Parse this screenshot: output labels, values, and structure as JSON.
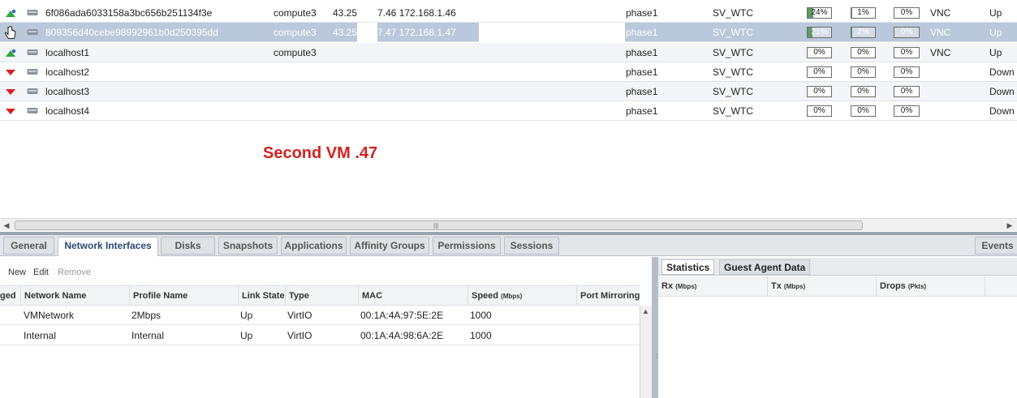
{
  "vm_rows": [
    {
      "name": "6f086ada6033158a3bc656b251134f3e",
      "host": "compute3",
      "ip_prefix": "43.25",
      "ip": "7.46 172.168.1.46",
      "cluster": "phase1",
      "datacenter": "SV_WTC",
      "cpu": "24%",
      "cpu_value": 24,
      "memory": "1%",
      "memory_value": 1,
      "network": "0%",
      "network_value": 0,
      "display": "VNC",
      "status": "Up",
      "state": "up"
    },
    {
      "name": "809356d40cebe98992961b0d250395dd",
      "host": "compute3",
      "ip_prefix": "43.25",
      "ip": "7.47 172.168.1.47",
      "cluster": "phase1",
      "datacenter": "SV_WTC",
      "cpu": "21%",
      "cpu_value": 21,
      "memory": "2%",
      "memory_value": 2,
      "network": "0%",
      "network_value": 0,
      "display": "VNC",
      "status": "Up",
      "state": "up"
    },
    {
      "name": "localhost1",
      "host": "compute3",
      "ip_prefix": "",
      "ip": "",
      "cluster": "phase1",
      "datacenter": "SV_WTC",
      "cpu": "0%",
      "cpu_value": 0,
      "memory": "0%",
      "memory_value": 0,
      "network": "0%",
      "network_value": 0,
      "display": "VNC",
      "status": "Up",
      "state": "up"
    },
    {
      "name": "localhost2",
      "host": "",
      "ip_prefix": "",
      "ip": "",
      "cluster": "phase1",
      "datacenter": "SV_WTC",
      "cpu": "0%",
      "cpu_value": 0,
      "memory": "0%",
      "memory_value": 0,
      "network": "0%",
      "network_value": 0,
      "display": "",
      "status": "Down",
      "state": "down"
    },
    {
      "name": "localhost3",
      "host": "",
      "ip_prefix": "",
      "ip": "",
      "cluster": "phase1",
      "datacenter": "SV_WTC",
      "cpu": "0%",
      "cpu_value": 0,
      "memory": "0%",
      "memory_value": 0,
      "network": "0%",
      "network_value": 0,
      "display": "",
      "status": "Down",
      "state": "down"
    },
    {
      "name": "localhost4",
      "host": "",
      "ip_prefix": "",
      "ip": "",
      "cluster": "phase1",
      "datacenter": "SV_WTC",
      "cpu": "0%",
      "cpu_value": 0,
      "memory": "0%",
      "memory_value": 0,
      "network": "0%",
      "network_value": 0,
      "display": "",
      "status": "Down",
      "state": "down"
    }
  ],
  "annotation": "Second VM .47",
  "tabs": [
    "General",
    "Network Interfaces",
    "Disks",
    "Snapshots",
    "Applications",
    "Affinity Groups",
    "Permissions",
    "Sessions"
  ],
  "active_tab": "Network Interfaces",
  "events_tab": "Events",
  "nic_toolbar": {
    "new": "New",
    "edit": "Edit",
    "remove": "Remove"
  },
  "nic_columns": {
    "plugged": "ged",
    "network_name": "Network Name",
    "profile_name": "Profile Name",
    "link_state": "Link State",
    "type": "Type",
    "mac": "MAC",
    "speed": "Speed",
    "speed_unit": "(Mbps)",
    "port_mirroring": "Port Mirroring"
  },
  "nics": [
    {
      "network_name": "VMNetwork",
      "profile_name": "2Mbps",
      "link_state": "Up",
      "type": "VirtIO",
      "mac": "00:1A:4A:97:5E:2E",
      "speed": "1000"
    },
    {
      "network_name": "Internal",
      "profile_name": "Internal",
      "link_state": "Up",
      "type": "VirtIO",
      "mac": "00:1A:4A:98:6A:2E",
      "speed": "1000"
    }
  ],
  "stats_tabs": {
    "statistics": "Statistics",
    "guest_agent": "Guest Agent Data"
  },
  "stats_columns": {
    "rx": "Rx",
    "rx_unit": "(Mbps)",
    "tx": "Tx",
    "tx_unit": "(Mbps)",
    "drops": "Drops",
    "drops_unit": "(Pkts)"
  },
  "colors": {
    "up_arrow": "#2fa83a",
    "down_arrow": "#d62020",
    "selected_row": "#b9c8da",
    "annotation": "#d62020",
    "progress_fill": "#5e9b62"
  }
}
